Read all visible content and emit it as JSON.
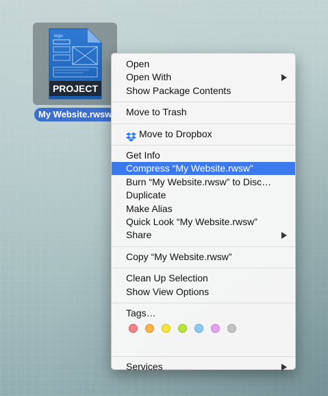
{
  "desktop": {
    "file": {
      "icon_name": "rwsw-document-icon",
      "icon_badge": "PROJECT",
      "icon_sketch_text": "logo",
      "name": "My Website.rwsw"
    }
  },
  "context_menu": {
    "groups": [
      [
        {
          "label": "Open",
          "submenu": false
        },
        {
          "label": "Open With",
          "submenu": true
        },
        {
          "label": "Show Package Contents",
          "submenu": false
        }
      ],
      [
        {
          "label": "Move to Trash",
          "submenu": false
        }
      ],
      [
        {
          "label": "Move to Dropbox",
          "submenu": false,
          "icon": "dropbox-icon"
        }
      ],
      [
        {
          "label": "Get Info",
          "submenu": false
        },
        {
          "label": "Compress “My Website.rwsw”",
          "submenu": false,
          "highlighted": true
        },
        {
          "label": "Burn “My Website.rwsw” to Disc…",
          "submenu": false
        },
        {
          "label": "Duplicate",
          "submenu": false
        },
        {
          "label": "Make Alias",
          "submenu": false
        },
        {
          "label": "Quick Look “My Website.rwsw”",
          "submenu": false
        },
        {
          "label": "Share",
          "submenu": true
        }
      ],
      [
        {
          "label": "Copy “My Website.rwsw”",
          "submenu": false
        }
      ],
      [
        {
          "label": "Clean Up Selection",
          "submenu": false
        },
        {
          "label": "Show View Options",
          "submenu": false
        }
      ],
      [
        {
          "label": "Tags…",
          "submenu": false
        }
      ],
      [
        {
          "label": "Services",
          "submenu": true
        }
      ]
    ],
    "tags": [
      {
        "name": "red",
        "color": "#f0838a",
        "border": "#d45e66"
      },
      {
        "name": "orange",
        "color": "#f9b34a",
        "border": "#db9128"
      },
      {
        "name": "yellow",
        "color": "#f7e33a",
        "border": "#d6c11c"
      },
      {
        "name": "green",
        "color": "#b9e23c",
        "border": "#94bf1e"
      },
      {
        "name": "blue",
        "color": "#8ec8f5",
        "border": "#63a5dc"
      },
      {
        "name": "purple",
        "color": "#e4a2ef",
        "border": "#c47dd2"
      },
      {
        "name": "gray",
        "color": "#c3c3c3",
        "border": "#a2a2a2"
      }
    ],
    "highlight_color": "#3d79ee"
  }
}
